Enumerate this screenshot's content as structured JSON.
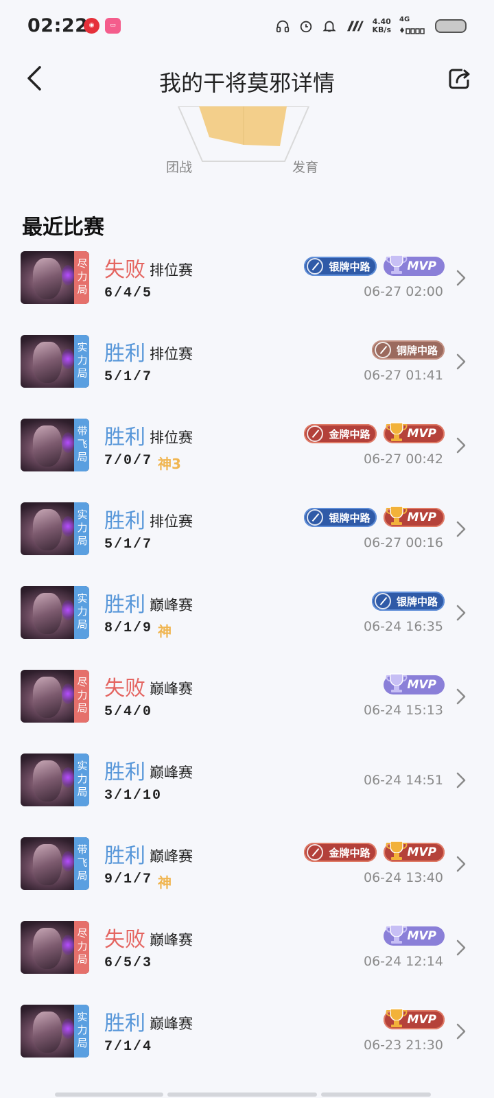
{
  "status_bar": {
    "time": "02:22",
    "net_speed_value": "4.40",
    "net_speed_unit": "KB/s",
    "net_type": "4G",
    "netease_icon": "netease-music-icon",
    "bili_icon": "bilibili-icon"
  },
  "header": {
    "title": "我的干将莫邪详情",
    "back_icon": "chevron-left-icon",
    "share_icon": "share-icon"
  },
  "radar": {
    "label_left": "团战",
    "label_right": "发育",
    "fill_color": "#f2c877"
  },
  "section_title": "最近比赛",
  "matches": [
    {
      "tag": "尽力局",
      "tag_color": "red",
      "result": "失败",
      "result_type": "lose",
      "mode": "排位赛",
      "kda": "6/4/5",
      "god": "",
      "badges": [
        "silver-mid",
        "mvp-purple"
      ],
      "time": "06-27 02:00"
    },
    {
      "tag": "实力局",
      "tag_color": "blue",
      "result": "胜利",
      "result_type": "win",
      "mode": "排位赛",
      "kda": "5/1/7",
      "god": "",
      "badges": [
        "bronze-mid"
      ],
      "time": "06-27 01:41"
    },
    {
      "tag": "带飞局",
      "tag_color": "blue",
      "result": "胜利",
      "result_type": "win",
      "mode": "排位赛",
      "kda": "7/0/7",
      "god": "神3",
      "badges": [
        "gold-mid",
        "mvp-gold"
      ],
      "time": "06-27 00:42"
    },
    {
      "tag": "实力局",
      "tag_color": "blue",
      "result": "胜利",
      "result_type": "win",
      "mode": "排位赛",
      "kda": "5/1/7",
      "god": "",
      "badges": [
        "silver-mid",
        "mvp-gold"
      ],
      "time": "06-27 00:16"
    },
    {
      "tag": "实力局",
      "tag_color": "blue",
      "result": "胜利",
      "result_type": "win",
      "mode": "巅峰赛",
      "kda": "8/1/9",
      "god": "神",
      "badges": [
        "silver-mid"
      ],
      "time": "06-24 16:35"
    },
    {
      "tag": "尽力局",
      "tag_color": "red",
      "result": "失败",
      "result_type": "lose",
      "mode": "巅峰赛",
      "kda": "5/4/0",
      "god": "",
      "badges": [
        "mvp-purple"
      ],
      "time": "06-24 15:13"
    },
    {
      "tag": "实力局",
      "tag_color": "blue",
      "result": "胜利",
      "result_type": "win",
      "mode": "巅峰赛",
      "kda": "3/1/10",
      "god": "",
      "badges": [],
      "time": "06-24 14:51"
    },
    {
      "tag": "带飞局",
      "tag_color": "blue",
      "result": "胜利",
      "result_type": "win",
      "mode": "巅峰赛",
      "kda": "9/1/7",
      "god": "神",
      "badges": [
        "gold-mid",
        "mvp-gold"
      ],
      "time": "06-24 13:40"
    },
    {
      "tag": "尽力局",
      "tag_color": "red",
      "result": "失败",
      "result_type": "lose",
      "mode": "巅峰赛",
      "kda": "6/5/3",
      "god": "",
      "badges": [
        "mvp-purple"
      ],
      "time": "06-24 12:14"
    },
    {
      "tag": "实力局",
      "tag_color": "blue",
      "result": "胜利",
      "result_type": "win",
      "mode": "巅峰赛",
      "kda": "7/1/4",
      "god": "",
      "badges": [
        "mvp-gold"
      ],
      "time": "06-23 21:30"
    }
  ],
  "badge_labels": {
    "silver-mid": "银牌中路",
    "bronze-mid": "铜牌中路",
    "gold-mid": "金牌中路",
    "mvp": "MVP"
  },
  "colors": {
    "win": "#5897d9",
    "lose": "#e46561",
    "god": "#f0b550",
    "tag_red": "#e5706b",
    "tag_blue": "#5a9fe0"
  }
}
